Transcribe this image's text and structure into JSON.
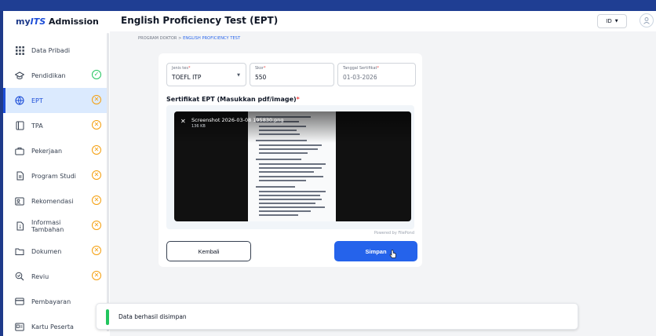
{
  "brand": {
    "my": "my",
    "its": "ITS",
    "admission": "Admission"
  },
  "page": {
    "title": "English Proficiency Test (EPT)"
  },
  "header": {
    "language": "ID"
  },
  "breadcrumb": {
    "parent": "PROGRAM DOKTOR",
    "separator": ">",
    "current": "ENGLISH PROFICIENCY TEST"
  },
  "sidebar": {
    "items": [
      {
        "label": "Data Pribadi",
        "icon": "grid-icon",
        "status": "none"
      },
      {
        "label": "Pendidikan",
        "icon": "graduation-cap-icon",
        "status": "complete"
      },
      {
        "label": "EPT",
        "icon": "globe-icon",
        "status": "incomplete",
        "active": true
      },
      {
        "label": "TPA",
        "icon": "book-icon",
        "status": "incomplete"
      },
      {
        "label": "Pekerjaan",
        "icon": "briefcase-icon",
        "status": "incomplete"
      },
      {
        "label": "Program Studi",
        "icon": "document-icon",
        "status": "incomplete"
      },
      {
        "label": "Rekomendasi",
        "icon": "contact-card-icon",
        "status": "incomplete"
      },
      {
        "label": "Informasi Tambahan",
        "icon": "info-document-icon",
        "status": "incomplete"
      },
      {
        "label": "Dokumen",
        "icon": "folder-icon",
        "status": "incomplete"
      },
      {
        "label": "Reviu",
        "icon": "review-icon",
        "status": "incomplete"
      },
      {
        "label": "Pembayaran",
        "icon": "credit-card-icon",
        "status": "none"
      },
      {
        "label": "Kartu Peserta",
        "icon": "id-card-icon",
        "status": "none"
      }
    ]
  },
  "form": {
    "test_type": {
      "label": "Jenis tes",
      "value": "TOEFL ITP"
    },
    "score": {
      "label": "Skor",
      "value": "550"
    },
    "certificate_date": {
      "label": "Tanggal Sertifikat",
      "value": "01-03-2026"
    },
    "certificate_section": "Sertifikat EPT (Masukkan pdf/image)",
    "file": {
      "name": "Screenshot 2026-03-08 195830.png",
      "size": "136 KB"
    },
    "powered_by": "Powered by FilePond",
    "back_label": "Kembali",
    "save_label": "Simpan"
  },
  "toast": {
    "message": "Data berhasil disimpan"
  },
  "colors": {
    "primary": "#2563eb",
    "success": "#22c55e",
    "warning": "#f59e0b",
    "frame": "#1e3a8a"
  }
}
